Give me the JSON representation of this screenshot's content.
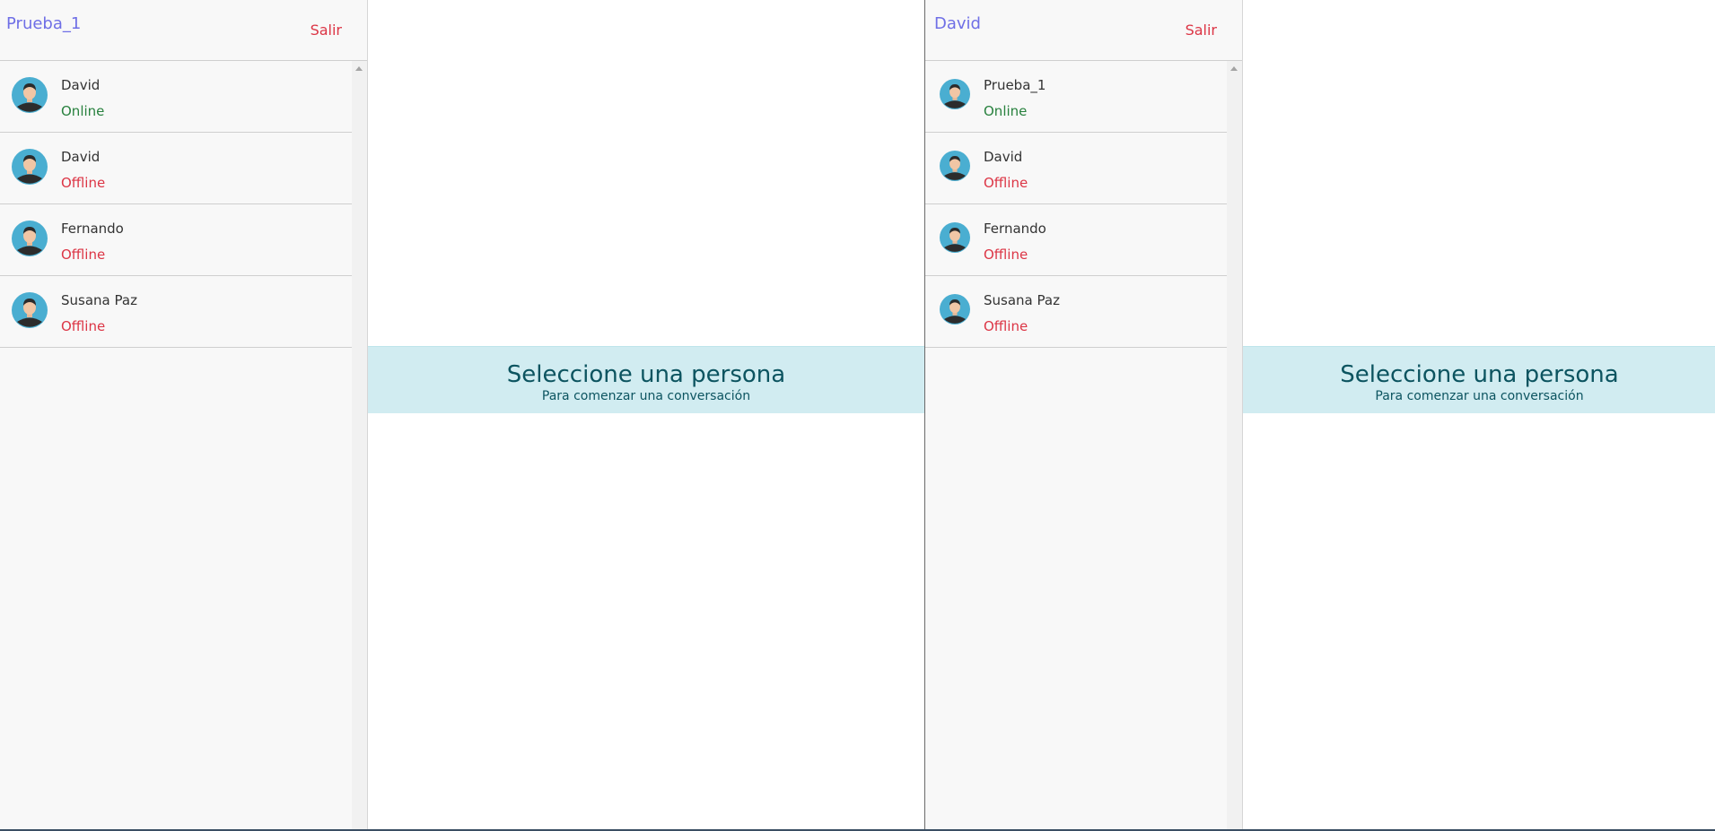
{
  "windows": [
    {
      "user": "Prueba_1",
      "logout_label": "Salir",
      "contacts": [
        {
          "name": "David",
          "status": "Online"
        },
        {
          "name": "David",
          "status": "Offline"
        },
        {
          "name": "Fernando",
          "status": "Offline"
        },
        {
          "name": "Susana Paz",
          "status": "Offline"
        }
      ],
      "banner": {
        "title": "Seleccione una persona",
        "subtitle": "Para comenzar una conversación"
      }
    },
    {
      "user": "David",
      "logout_label": "Salir",
      "contacts": [
        {
          "name": "Prueba_1",
          "status": "Online"
        },
        {
          "name": "David",
          "status": "Offline"
        },
        {
          "name": "Fernando",
          "status": "Offline"
        },
        {
          "name": "Susana Paz",
          "status": "Offline"
        }
      ],
      "banner": {
        "title": "Seleccione una persona",
        "subtitle": "Para comenzar una conversación"
      }
    }
  ],
  "icons": {
    "avatar": "user-avatar-icon",
    "scroll": "scroll-up-arrow-icon"
  },
  "colors": {
    "online": "#28813e",
    "offline": "#dc3545",
    "user_title": "#6f6fe6",
    "banner_bg": "#d1ecf1",
    "banner_text": "#0c5460"
  }
}
